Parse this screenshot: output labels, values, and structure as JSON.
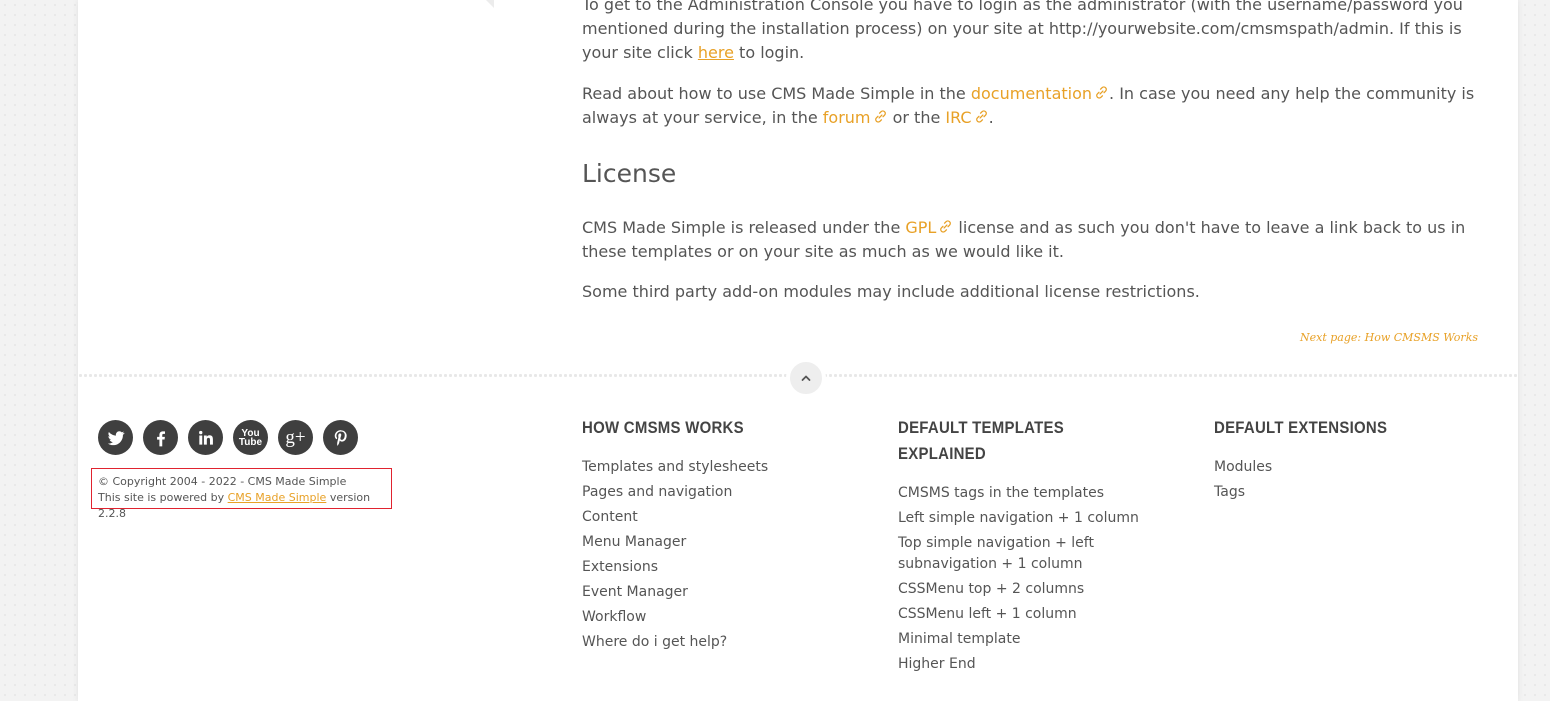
{
  "content": {
    "p1_text": "To get to the Administration Console you have to login as the administrator (with the username/password you mentioned during the installation process) on your site at http://yourwebsite.com/cmsmspath/admin. If this is your site click ",
    "p1_link": "here",
    "p1_tail": " to login.",
    "p2_a": "Read about how to use CMS Made Simple in the ",
    "p2_link_doc": "documentation",
    "p2_b": ". In case you need any help the community is always at your service, in the ",
    "p2_link_forum": "forum",
    "p2_c": " or the ",
    "p2_link_irc": "IRC",
    "p2_d": ".",
    "license_heading": "License",
    "p3_a": "CMS Made Simple is released under the ",
    "p3_link_gpl": "GPL",
    "p3_b": " license and as such you don't have to leave a link back to us in these templates or on your site as much as we would like it.",
    "p4": "Some third party add-on modules may include additional license restrictions.",
    "next_page": "Next page: How CMSMS Works"
  },
  "social": {
    "icons": [
      "twitter-icon",
      "facebook-icon",
      "linkedin-icon",
      "youtube-icon",
      "google-plus-icon",
      "pinterest-icon"
    ],
    "youtube_top": "You",
    "youtube_bottom": "Tube",
    "gplus": "g+"
  },
  "copyright": {
    "line1": "© Copyright 2004 - 2022 - CMS Made Simple",
    "line2_a": "This site is powered by ",
    "line2_link": "CMS Made Simple",
    "line2_b": " version 2.2.8"
  },
  "footer": {
    "col1": {
      "title": "HOW CMSMS WORKS",
      "items": [
        "Templates and stylesheets",
        "Pages and navigation",
        "Content",
        "Menu Manager",
        "Extensions",
        "Event Manager",
        "Workflow",
        "Where do i get help?"
      ]
    },
    "col2": {
      "title": "DEFAULT TEMPLATES EXPLAINED",
      "items": [
        "CMSMS tags in the templates",
        "Left simple navigation + 1 column",
        "Top simple navigation + left subnavigation + 1 column",
        "CSSMenu top + 2 columns",
        "CSSMenu left + 1 column",
        "Minimal template",
        "Higher End"
      ]
    },
    "col3": {
      "title": "DEFAULT EXTENSIONS",
      "items": [
        "Modules",
        "Tags"
      ]
    }
  },
  "colors": {
    "accent": "#e8a127",
    "text": "#555555",
    "social_bg": "#3f3f3f",
    "highlight_border": "#e0232f"
  }
}
